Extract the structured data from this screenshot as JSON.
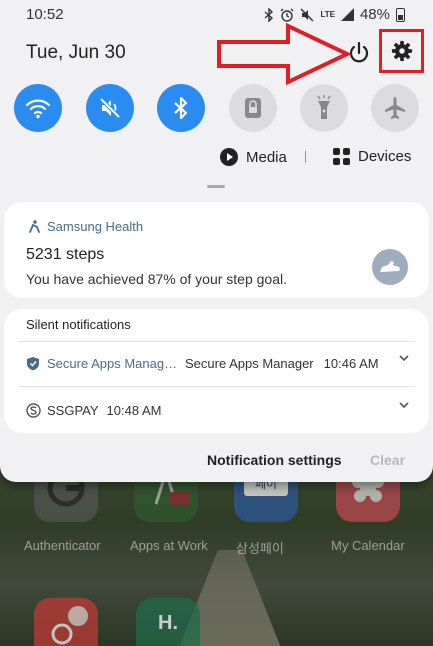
{
  "status_bar": {
    "time": "10:52",
    "lte": "LTE",
    "battery_percent": "48%"
  },
  "panel": {
    "date": "Tue, Jun 30"
  },
  "quick_settings": [
    {
      "name": "wifi",
      "state": "on"
    },
    {
      "name": "sound-mute",
      "state": "on"
    },
    {
      "name": "bluetooth",
      "state": "on"
    },
    {
      "name": "screen-lock",
      "state": "off"
    },
    {
      "name": "flashlight",
      "state": "off"
    },
    {
      "name": "airplane-mode",
      "state": "off"
    }
  ],
  "media_row": {
    "media_label": "Media",
    "devices_label": "Devices"
  },
  "health_notification": {
    "app": "Samsung Health",
    "title": "5231 steps",
    "body": "You have achieved 87% of your step goal."
  },
  "silent": {
    "header": "Silent notifications",
    "items": [
      {
        "app": "Secure Apps Manag…",
        "title": "Secure Apps Manager",
        "time": "10:46 AM"
      },
      {
        "app": "SSGPAY",
        "time": "10:48 AM"
      }
    ]
  },
  "footer": {
    "settings_label": "Notification settings",
    "clear_label": "Clear"
  },
  "home_apps": [
    {
      "label": "Authenticator"
    },
    {
      "label": "Apps at Work"
    },
    {
      "label": "삼성페이",
      "badge": "페이"
    },
    {
      "label": "My Calendar"
    },
    {
      "label": ""
    },
    {
      "label": "",
      "badge": "H."
    }
  ],
  "colors": {
    "accent": "#2a8cf0",
    "highlight": "#e01e26",
    "panel_bg": "#f1f1f3"
  }
}
